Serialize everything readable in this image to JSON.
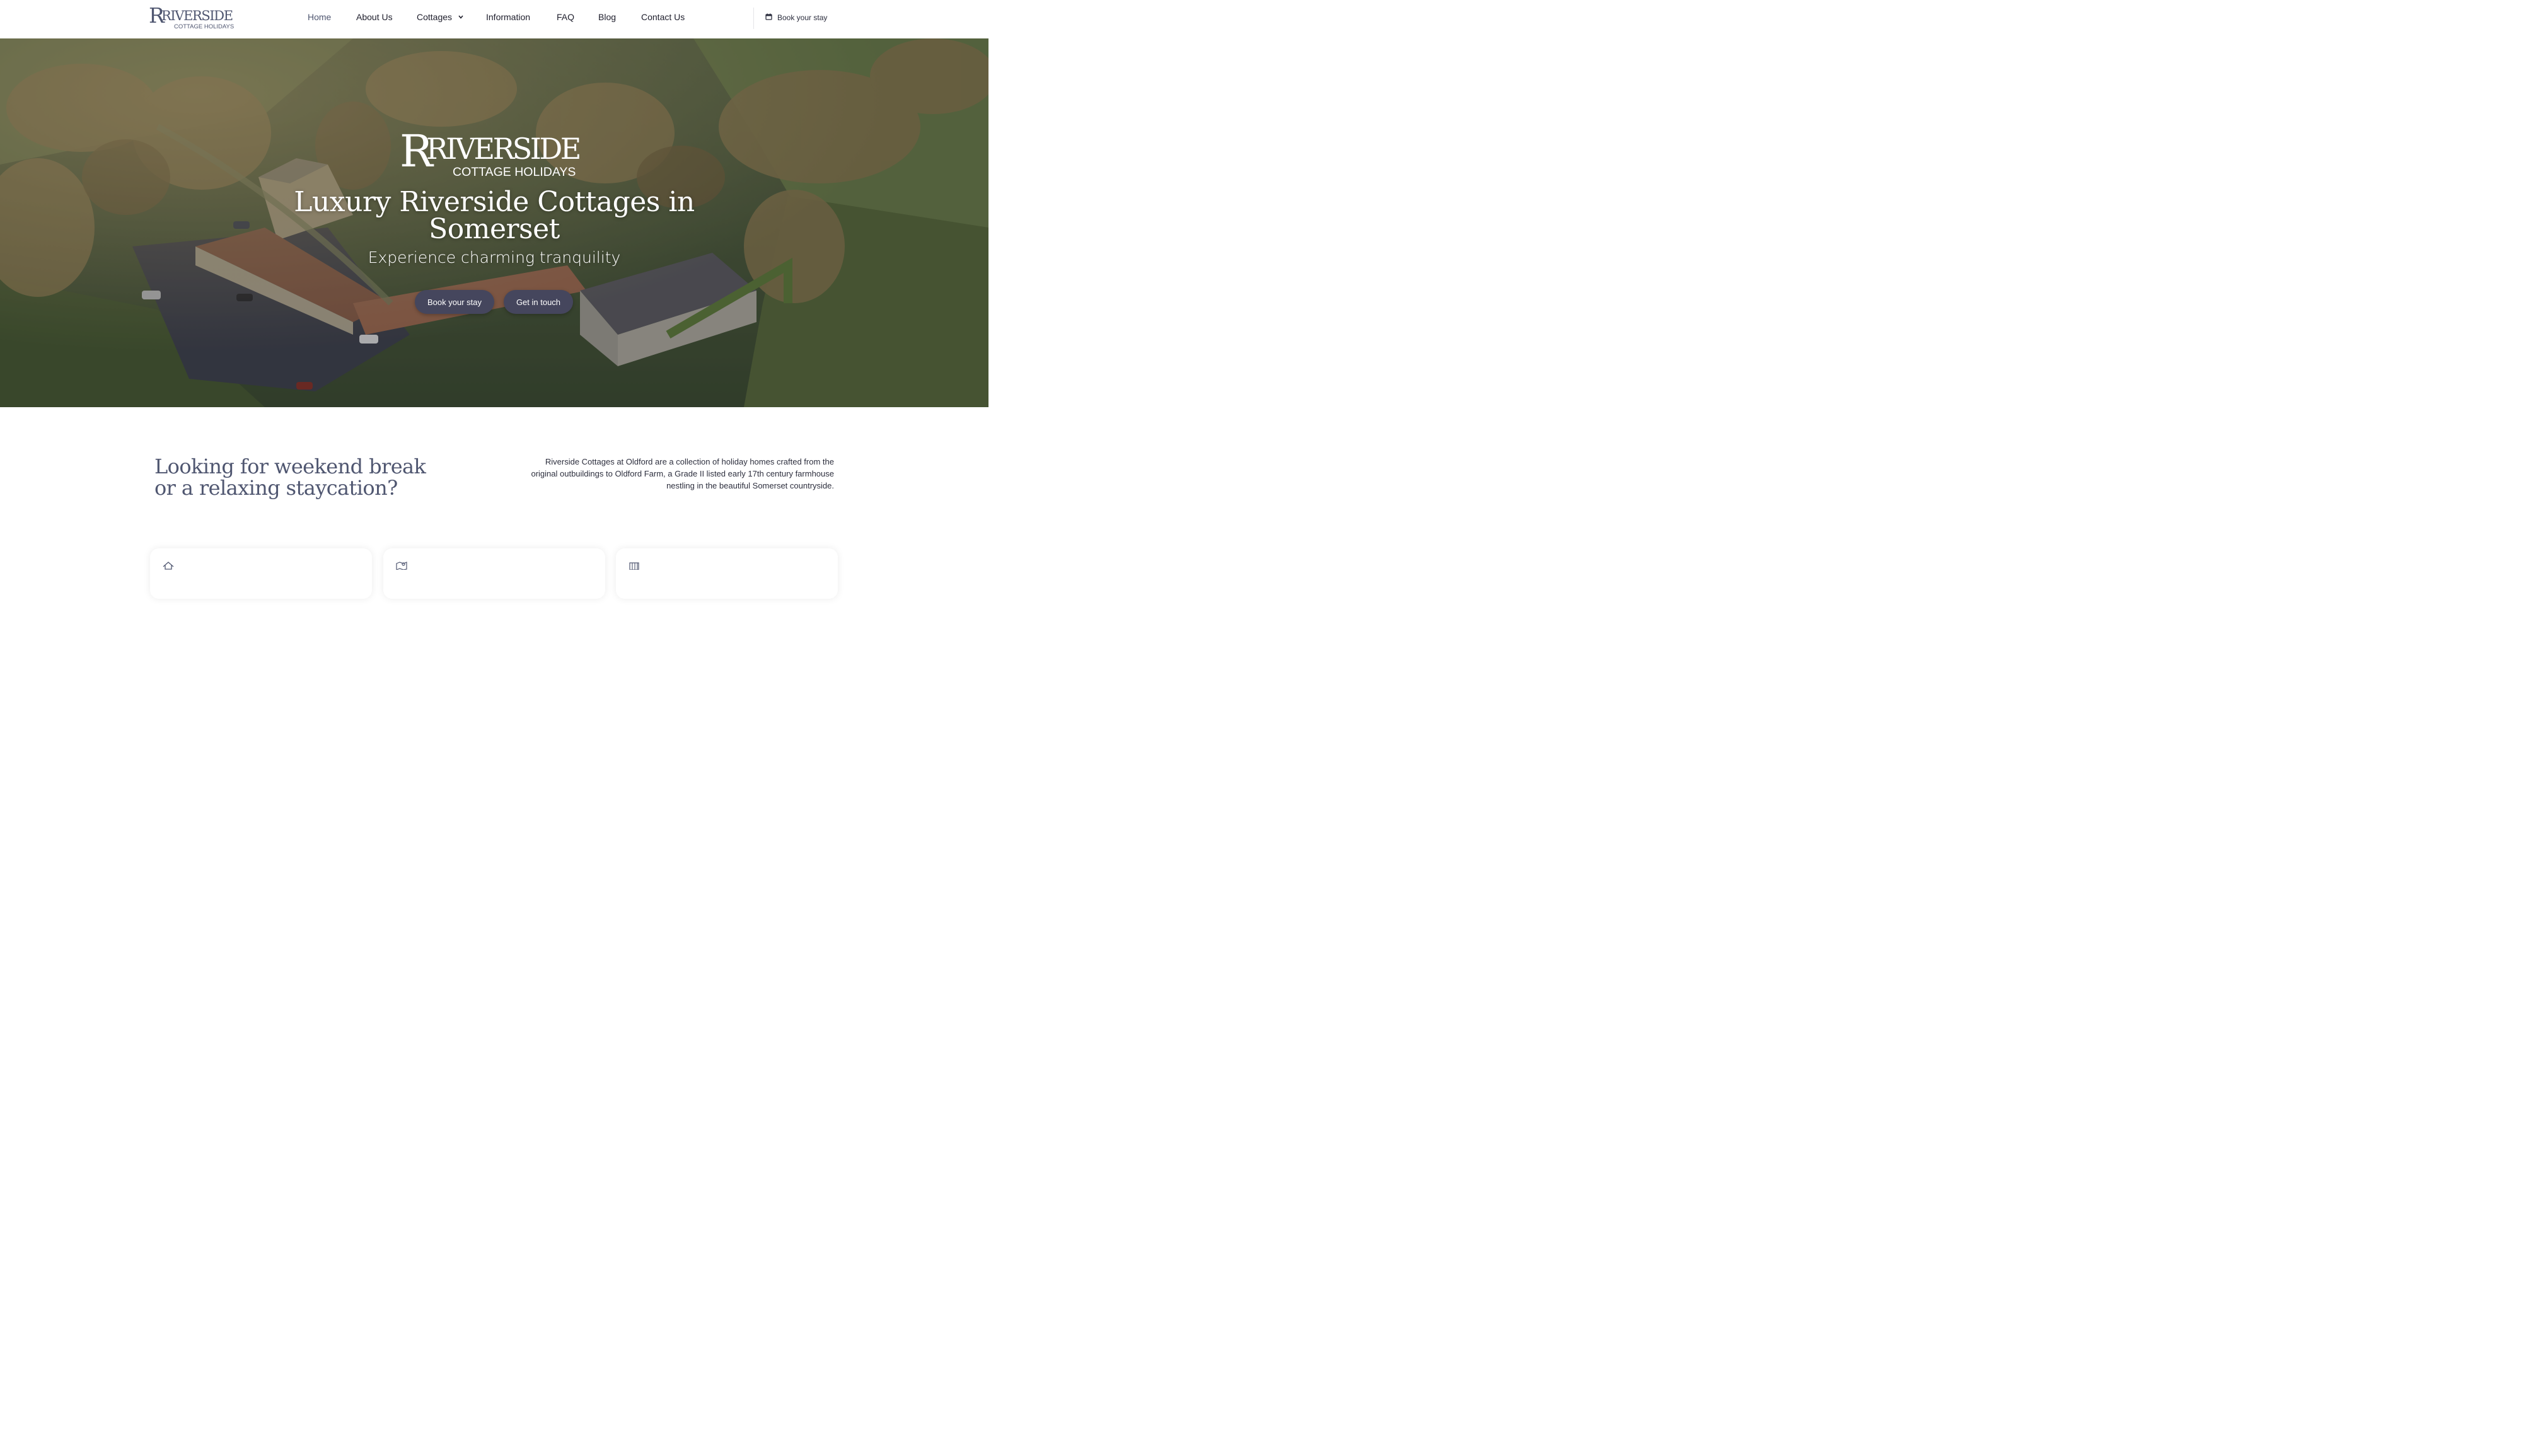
{
  "brand": {
    "name": "RIVERSIDE",
    "tagline": "COTTAGE HOLIDAYS",
    "primary_color": "#4f5670",
    "button_color": "#45465d"
  },
  "nav": {
    "items": [
      {
        "label": "Home",
        "active": true
      },
      {
        "label": "About Us",
        "active": false
      },
      {
        "label": "Cottages",
        "active": false,
        "has_dropdown": true
      },
      {
        "label": "Information",
        "active": false
      },
      {
        "label": "FAQ",
        "active": false
      },
      {
        "label": "Blog",
        "active": false
      },
      {
        "label": "Contact Us",
        "active": false
      }
    ],
    "book_label": "Book your stay",
    "book_icon": "calendar-icon"
  },
  "hero": {
    "title": "Luxury Riverside Cottages in Somerset",
    "subtitle": "Experience charming tranquility",
    "buttons": {
      "book": "Book your stay",
      "touch": "Get in touch"
    }
  },
  "intro": {
    "heading": "Looking for weekend break or a relaxing staycation?",
    "text": "Riverside Cottages at Oldford are a collection of holiday homes crafted from the original outbuildings to Oldford Farm, a Grade II listed early 17th century farmhouse nestling in the beautiful Somerset countryside."
  },
  "cards": [
    {
      "icon": "house-icon"
    },
    {
      "icon": "map-pin-icon"
    },
    {
      "icon": "building-icon"
    }
  ]
}
